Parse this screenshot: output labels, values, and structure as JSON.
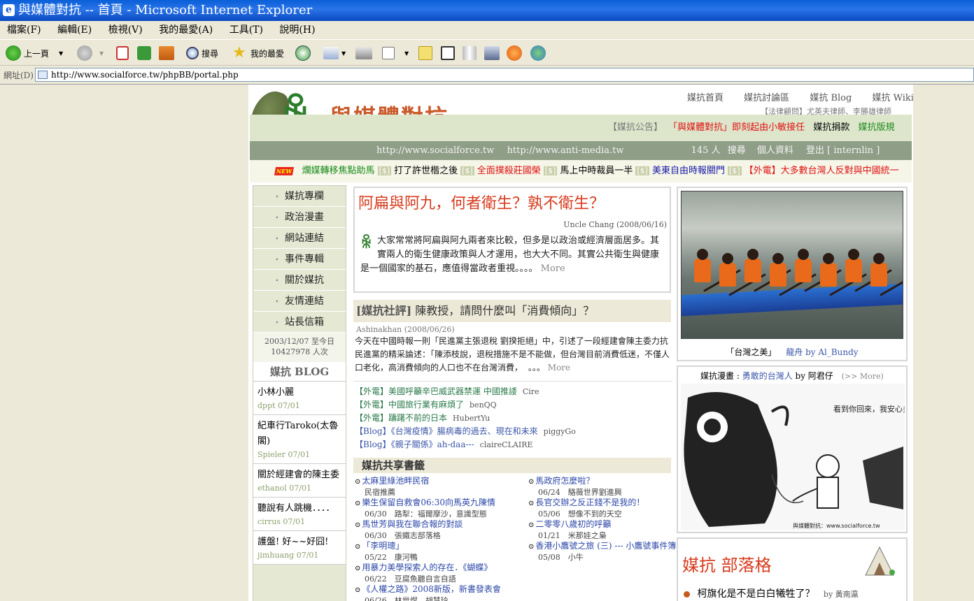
{
  "window": {
    "title": "與媒體對抗 -- 首頁 - Microsoft Internet Explorer"
  },
  "menu": [
    "檔案(F)",
    "編輯(E)",
    "檢視(V)",
    "我的最愛(A)",
    "工具(T)",
    "說明(H)"
  ],
  "toolbar": {
    "back": "上一頁",
    "search": "搜尋",
    "favorites": "我的最愛"
  },
  "address": {
    "label": "網址(D)",
    "url": "http://www.socialforce.tw/phpBB/portal.php"
  },
  "site": {
    "name": "與媒體對抗",
    "topnav": [
      "媒抗首頁",
      "媒抗討論區",
      "媒抗 Blog",
      "媒抗 Wiki"
    ],
    "lawyer": "【法律顧問】尤英夫律師、李勝雄律師",
    "announce_tag": "【媒抗公告】",
    "announce_1": "「與媒體對抗」即刻起由小敏接任",
    "announce_2": "媒抗捐款",
    "announce_3": "媒抗版規",
    "url1": "http://www.socialforce.tw",
    "url2": "http://www.anti-media.tw",
    "online": "145 人",
    "search": "搜尋",
    "profile": "個人資料",
    "logout": "登出 [ internlin ]"
  },
  "ticker": {
    "new_badge": "NEW",
    "sep": "[$]",
    "items": [
      {
        "text": "爛媒轉移焦點助馬",
        "color": "#1a8a1a"
      },
      {
        "text": "打了許世楷之後",
        "color": "#000000"
      },
      {
        "text": "全面撲殺莊國榮",
        "color": "#e01010"
      },
      {
        "text": "馬上中時裁員一半",
        "color": "#000000"
      },
      {
        "text": "美東自由時報關門",
        "color": "#1a1aa8"
      },
      {
        "text": "【外電】大多數台灣人反對與中國統一",
        "color": "#e01010"
      }
    ]
  },
  "left": {
    "menu": [
      "媒抗專欄",
      "政治漫畫",
      "網站連結",
      "事件專輯",
      "關於媒抗",
      "友情連結",
      "站長信箱"
    ],
    "counter_1": "2003/12/07 至今日",
    "counter_2": "10427978 人次",
    "blog_title": "媒抗 BLOG",
    "blogs": [
      {
        "title": "小林小麗",
        "meta": "dppt 07/01"
      },
      {
        "title": "紀車行Taroko(太魯閣)",
        "meta": "Spieler 07/01"
      },
      {
        "title": "關於經建會的陳主委",
        "meta": "ethanol 07/01"
      },
      {
        "title": "聽說有人跳機．．．．",
        "meta": "cirrus 07/01"
      },
      {
        "title": "護盤! 好~~好囧!",
        "meta": "jimhuang 07/01"
      }
    ]
  },
  "main": {
    "article1": {
      "title": "阿扁與阿九，何者衛生？孰不衛生？",
      "byline": "Uncle Chang (2008/06/16)",
      "body": "大家常常將阿扁與阿九兩者來比較，但多是以政治或經濟層面居多。其實兩人的衛生健康政策與人才運用，也大大不同。其實公共衛生與健康是一個國家的基石，應值得當政者重視。。。。",
      "more": "More"
    },
    "article2": {
      "tag": "[媒抗社評]",
      "title": "陳教授，請問什麼叫「消費傾向」？",
      "byline": "Ashinakhan (2008/06/26)",
      "body": "今天在中國時報一則「民進黨主張退稅 劉揆拒絕」中，引述了一段經建會陳主委力抗民進黨的精采論述：「陳添枝說，退稅措施不是不能做，但台灣目前消費低迷，不僅人口老化，高消費傾向的人口也不在台灣消費，",
      "ellipsis": "。。。",
      "more": "More"
    },
    "links": [
      {
        "title": "【外電】美國呼籲辛巴威武器禁運 中國推諉",
        "user": "Cire",
        "kind": "news"
      },
      {
        "title": "【外電】中國旅行業有麻煩了",
        "user": "benQQ",
        "kind": "news"
      },
      {
        "title": "【外電】躊躇不前的日本",
        "user": "HubertYu",
        "kind": "news"
      },
      {
        "title": "【Blog】《台灣疫情》腸病毒的過去、現在和未來",
        "user": "piggyGo",
        "kind": "blog"
      },
      {
        "title": "【Blog】《親子關係》ah-daa---",
        "user": "claireCLAIRE",
        "kind": "blog"
      }
    ],
    "bookmarks_title": "媒抗共享書籤",
    "bookmarks_left": [
      {
        "title": "太麻里綠池畔民宿",
        "sub": "民宿推薦"
      },
      {
        "title": "樂生保留自救會06:30向馬英九陳情",
        "sub": "06/30　路犁：福爾摩沙，意識型態"
      },
      {
        "title": "馬世芳與我在聯合報的對談",
        "sub": "06/30　張鐵志部落格"
      },
      {
        "title": "「李明璁」",
        "sub": "05/22　康河鴨"
      },
      {
        "title": "用暴力美學探索人的存在．《蝴蝶》",
        "sub": "06/22　豆腐魚聽自言自語"
      },
      {
        "title": "《人權之路》2008新版，新書發表會",
        "sub": "06/26　林世煜．胡慧玲"
      }
    ],
    "bookmarks_right": [
      {
        "title": "馬政府怎麼啦？",
        "sub": "06/24　駱薇世界劉進興"
      },
      {
        "title": "長官交辦之反正錢不是我的！",
        "sub": "05/06　想像不到的天空"
      },
      {
        "title": "二零零八歲初的呼籲",
        "sub": "01/21　米那娃之梟"
      },
      {
        "title": "香港小鷹號之旅 (三) --- 小鷹號事件簿",
        "sub": "05/08　小牛"
      }
    ]
  },
  "right": {
    "photo_caption": "「台灣之美」",
    "photo_link": "龍舟 by Al_Bundy",
    "comic_label": "媒抗漫畫",
    "comic_title": "勇敢的台灣人",
    "comic_by": "by 阿君仔",
    "comic_more": "(>> More)",
    "comic_bubble": "看到你回來，我安心多了…",
    "comic_footer": "與媒體對抗：www.socialforce.tw",
    "blogger_title": "媒抗 部落格",
    "blogger_post": "柯旗化是不是白白犧牲了？",
    "blogger_by": "by 黃南瀛"
  },
  "colors": {
    "accent_red": "#d73b1e",
    "link_blue": "#3a56a8",
    "link_green": "#2a7a4a",
    "header_green": "#8f9e87"
  }
}
